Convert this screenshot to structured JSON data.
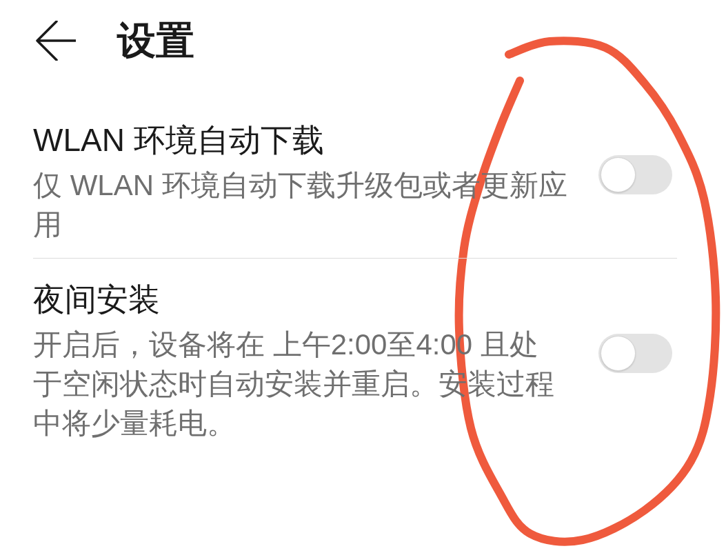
{
  "header": {
    "title": "设置"
  },
  "settings": [
    {
      "title": "WLAN 环境自动下载",
      "description": "仅 WLAN 环境自动下载升级包或者更新应用",
      "on": false
    },
    {
      "title": "夜间安装",
      "description": "开启后，设备将在 上午2:00至4:00 且处于空闲状态时自动安装并重启。安装过程中将少量耗电。",
      "on": false
    }
  ]
}
